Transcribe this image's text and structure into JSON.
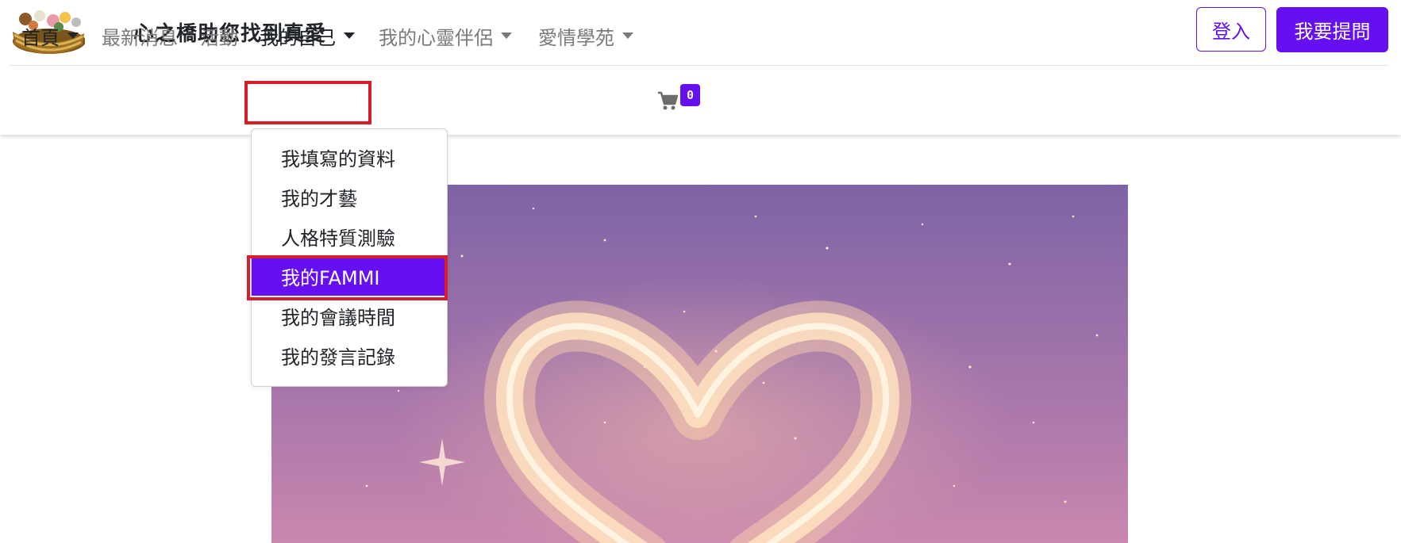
{
  "header": {
    "logo": "ark-logo",
    "site_title": "心之橋助您找到真愛",
    "login_label": "登入",
    "ask_label": "我要提問"
  },
  "nav": {
    "items": [
      {
        "label": "首頁",
        "has_caret": true
      },
      {
        "label": "最新消息",
        "has_caret": false
      },
      {
        "label": "活動",
        "has_caret": false
      },
      {
        "label": "我的自己",
        "has_caret": true,
        "open": true
      },
      {
        "label": "我的心靈伴侶",
        "has_caret": true
      },
      {
        "label": "愛情學苑",
        "has_caret": true
      }
    ],
    "cart_icon": "shopping-cart-icon",
    "cart_count": "0"
  },
  "dropdown": {
    "items": [
      {
        "label": "我填寫的資料"
      },
      {
        "label": "我的才藝"
      },
      {
        "label": "人格特質測驗"
      },
      {
        "label": "我的FAMMI",
        "active": true
      },
      {
        "label": "我的會議時間"
      },
      {
        "label": "我的發言記錄"
      }
    ]
  },
  "hero": {
    "image": "glowing-heart-night-sky"
  },
  "colors": {
    "accent": "#6610f2",
    "highlight_box": "#d81e2a",
    "hero_top": "#7e64a6",
    "hero_bottom": "#c987ae",
    "heart_glow": "#ffd2a0"
  }
}
